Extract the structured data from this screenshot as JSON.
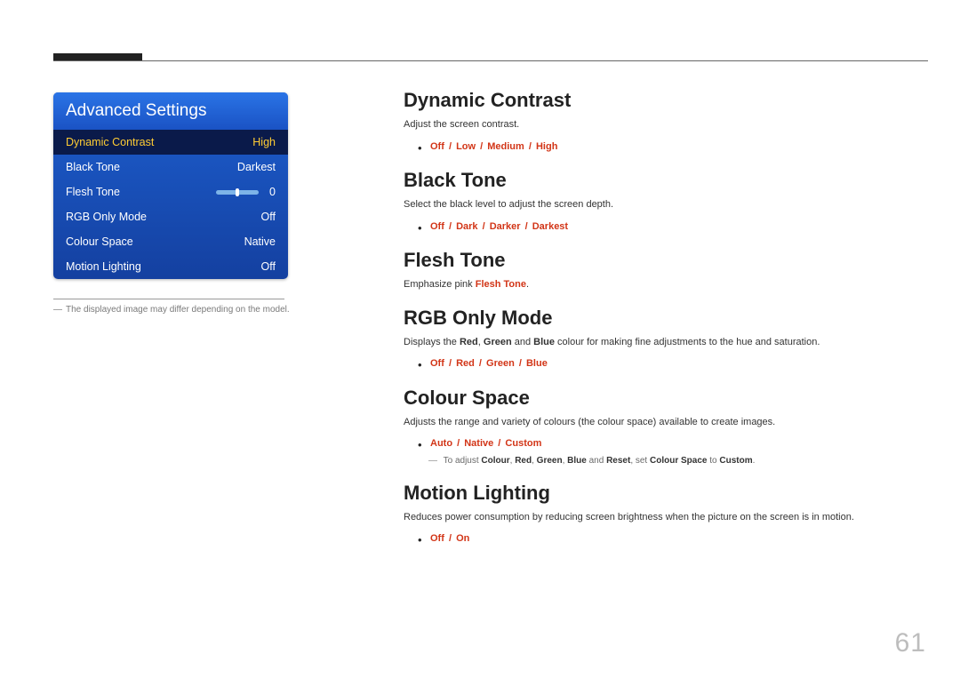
{
  "page_number": "61",
  "osd": {
    "title": "Advanced Settings",
    "rows": [
      {
        "label": "Dynamic Contrast",
        "value": "High",
        "selected": true
      },
      {
        "label": "Black Tone",
        "value": "Darkest"
      },
      {
        "label": "Flesh Tone",
        "value": "0",
        "slider": true
      },
      {
        "label": "RGB Only Mode",
        "value": "Off"
      },
      {
        "label": "Colour Space",
        "value": "Native"
      },
      {
        "label": "Motion Lighting",
        "value": "Off"
      }
    ]
  },
  "footnote_left": "The displayed image may differ depending on the model.",
  "sections": {
    "dynamic_contrast": {
      "title": "Dynamic Contrast",
      "desc": "Adjust the screen contrast.",
      "options": [
        "Off",
        "Low",
        "Medium",
        "High"
      ]
    },
    "black_tone": {
      "title": "Black Tone",
      "desc": "Select the black level to adjust the screen depth.",
      "options": [
        "Off",
        "Dark",
        "Darker",
        "Darkest"
      ]
    },
    "flesh_tone": {
      "title": "Flesh Tone",
      "desc_pre": "Emphasize pink ",
      "desc_hl": "Flesh Tone",
      "desc_post": "."
    },
    "rgb_only": {
      "title": "RGB Only Mode",
      "desc_pre": "Displays the ",
      "w_red": "Red",
      "c1": ", ",
      "w_green": "Green",
      "c2": " and ",
      "w_blue": "Blue",
      "desc_post": " colour for making fine adjustments to the hue and saturation.",
      "options": [
        "Off",
        "Red",
        "Green",
        "Blue"
      ]
    },
    "colour_space": {
      "title": "Colour Space",
      "desc": "Adjusts the range and variety of colours (the colour space) available to create images.",
      "options": [
        "Auto",
        "Native",
        "Custom"
      ],
      "note_pre": "To adjust ",
      "n_colour": "Colour",
      "n_c1": ", ",
      "n_red": "Red",
      "n_c2": ", ",
      "n_green": "Green",
      "n_c3": ", ",
      "n_blue": "Blue",
      "n_c4": " and ",
      "n_reset": "Reset",
      "n_mid": ", set ",
      "n_cs": "Colour Space",
      "n_to": " to ",
      "n_custom": "Custom",
      "n_end": "."
    },
    "motion_lighting": {
      "title": "Motion Lighting",
      "desc": "Reduces power consumption by reducing screen brightness when the picture on the screen is in motion.",
      "options": [
        "Off",
        "On"
      ]
    }
  }
}
